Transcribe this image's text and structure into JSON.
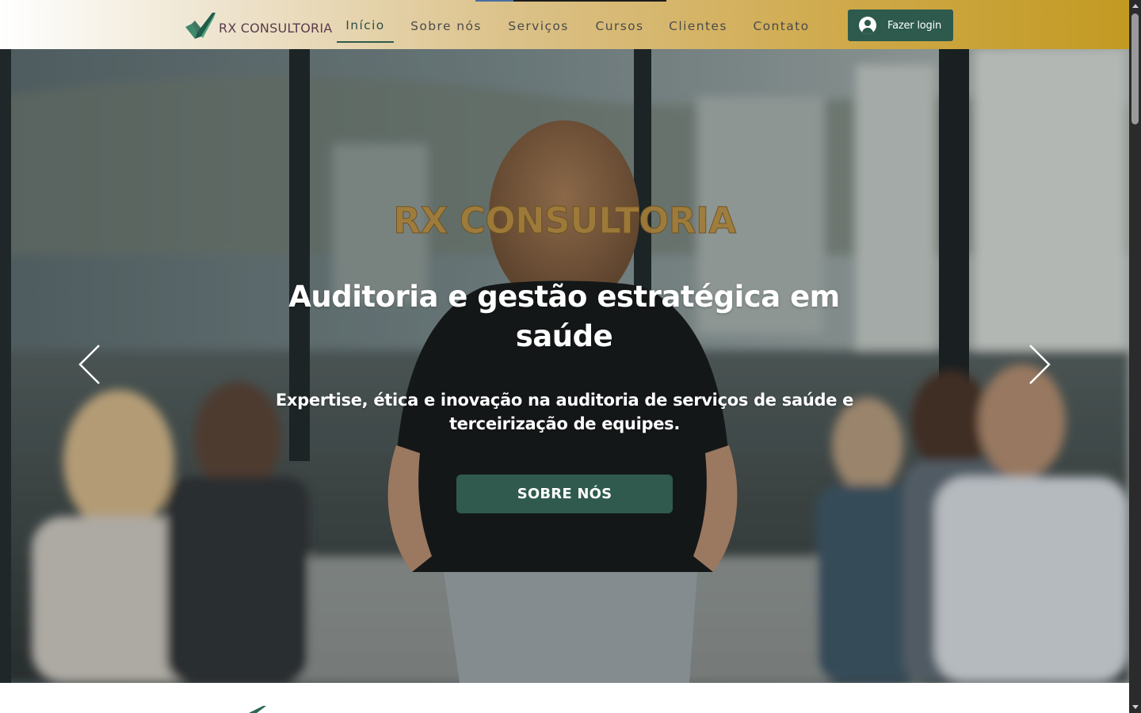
{
  "header": {
    "brand": "RX CONSULTORIA",
    "logo_icon": "checkmark-logo-icon",
    "nav": [
      {
        "label": "Início",
        "active": true
      },
      {
        "label": "Sobre nós",
        "active": false
      },
      {
        "label": "Serviços",
        "active": false
      },
      {
        "label": "Cursos",
        "active": false
      },
      {
        "label": "Clientes",
        "active": false
      },
      {
        "label": "Contato",
        "active": false
      }
    ],
    "login_label": "Fazer login",
    "login_icon": "user-avatar-icon"
  },
  "hero": {
    "brand_heading": "RX CONSULTORIA",
    "title": "Auditoria e gestão estratégica em saúde",
    "subtitle": "Expertise, ética e inovação na auditoria de serviços de saúde e terceirização de equipes.",
    "cta_label": "SOBRE NÓS",
    "prev_icon": "chevron-left-icon",
    "next_icon": "chevron-right-icon"
  },
  "colors": {
    "primary_green": "#2d5a4c",
    "gold": "#c29a22",
    "brand_heading": "#a07c3a",
    "brand_text": "#5a3a4e"
  }
}
